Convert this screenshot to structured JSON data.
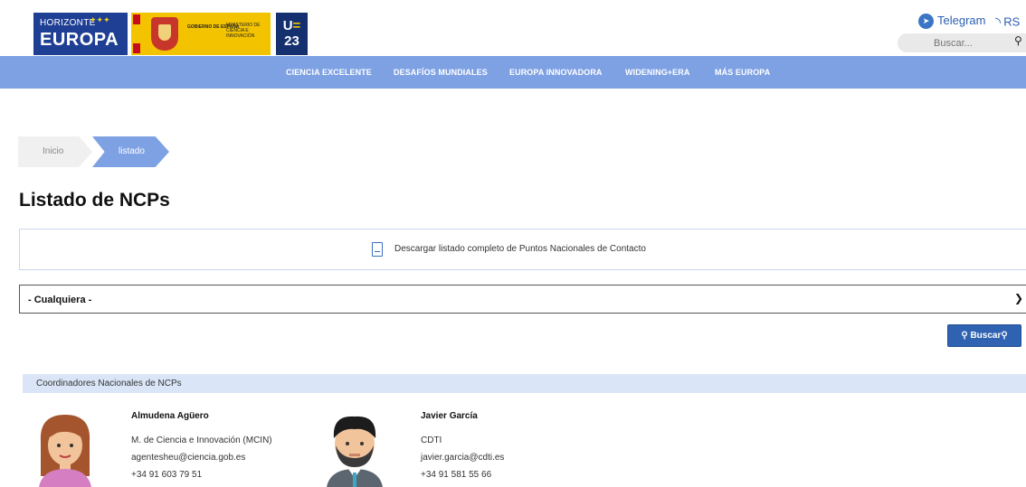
{
  "header": {
    "logo_horizonte": "HORIZONTE",
    "logo_europa": "EUROPA",
    "gob_label": "GOBIERNO DE ESPAÑA",
    "ministerio_label": "MINISTERIO DE CIENCIA E INNOVACIÓN",
    "ue_line1": "U",
    "ue_eq": "=",
    "ue_line2": "23",
    "telegram": "Telegram",
    "rss": "RS",
    "search_placeholder": "Buscar..."
  },
  "nav": {
    "items": [
      "CIENCIA EXCELENTE",
      "DESAFÍOS MUNDIALES",
      "EUROPA INNOVADORA",
      "WIDENING+ERA",
      "MÁS EUROPA"
    ]
  },
  "breadcrumb": {
    "home": "Inicio",
    "current": "listado"
  },
  "main": {
    "title": "Listado de NCPs",
    "download_text": "Descargar listado completo de Puntos Nacionales de Contacto",
    "select_value": "- Cualquiera -",
    "search_button": "Buscar"
  },
  "coordinators": {
    "section_title": "Coordinadores Nacionales de NCPs",
    "people": [
      {
        "name": "Almudena Agüero",
        "org": "M. de Ciencia e Innovación (MCIN)",
        "email": "agentesheu@ciencia.gob.es",
        "phone": "+34 91 603 79 51"
      },
      {
        "name": "Javier García",
        "org": "CDTI",
        "email": "javier.garcia@cdti.es",
        "phone": "+34 91 581 55 66"
      }
    ]
  },
  "colors": {
    "nav_bg": "#7ea1e4",
    "button_bg": "#2f63b2",
    "section_bg": "#dae6f8"
  }
}
